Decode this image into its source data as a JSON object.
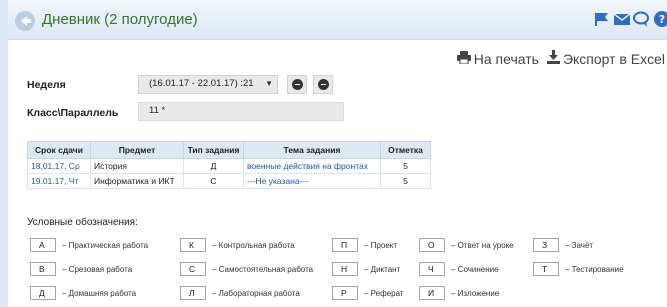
{
  "header": {
    "title": "Дневник (2 полугодие)",
    "icons": [
      "back-icon",
      "flag-icon",
      "mail-icon",
      "chat-icon",
      "help-icon"
    ]
  },
  "actions": {
    "print_label": "На печать",
    "export_label": "Экспорт в Excel"
  },
  "filters": {
    "week_label": "Неделя",
    "week_value": "(16.01.17 - 22.01.17) :21",
    "class_label": "Класс\\Параллель",
    "class_value": "11 *"
  },
  "table": {
    "headers": [
      "Срок сдачи",
      "Предмет",
      "Тип задания",
      "Тема задания",
      "Отметка"
    ],
    "rows": [
      [
        "18.01.17, Ср",
        "История",
        "Д",
        "военные действия на фронтах",
        "5"
      ],
      [
        "19.01.17, Чт",
        "Информатика и ИКТ",
        "С",
        "---Не указана---",
        "5"
      ]
    ]
  },
  "legend": {
    "title": "Условные обозначения:",
    "items": [
      {
        "code": "А",
        "text": "– Практическая работа"
      },
      {
        "code": "К",
        "text": "– Контрольная работа"
      },
      {
        "code": "П",
        "text": "– Проект"
      },
      {
        "code": "О",
        "text": "– Ответ на уроке"
      },
      {
        "code": "З",
        "text": "– Зачёт"
      },
      {
        "code": "В",
        "text": "– Срезовая работа"
      },
      {
        "code": "С",
        "text": "– Самостоятельная работа"
      },
      {
        "code": "Н",
        "text": "– Диктант"
      },
      {
        "code": "Ч",
        "text": "– Сочинение"
      },
      {
        "code": "Т",
        "text": "– Тестирование"
      },
      {
        "code": "Д",
        "text": "– Домашняя работа"
      },
      {
        "code": "Л",
        "text": "– Лабораторная работа"
      },
      {
        "code": "Р",
        "text": "– Реферат"
      },
      {
        "code": "И",
        "text": "– Изложение"
      }
    ]
  },
  "colors": {
    "title_green": "#2e7a28",
    "link_blue": "#1e5aa8",
    "icon_blue": "#2a6fc4",
    "header_bg": "#dde8f3"
  }
}
